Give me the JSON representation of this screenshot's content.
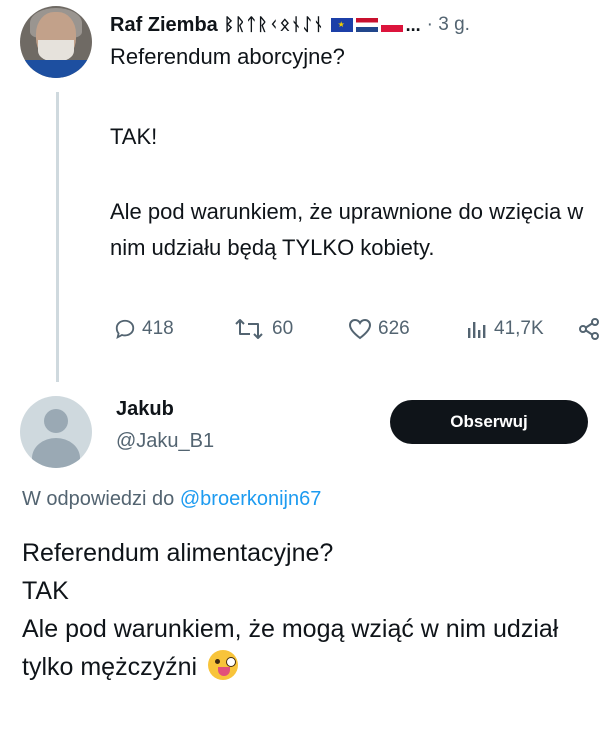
{
  "original_tweet": {
    "display_name": "Raf Ziemba",
    "name_runes": "ᛒᚱᛏᚱᚲᛟᚾᛇᚾ",
    "flags": [
      "eu-flag",
      "netherlands-flag",
      "poland-flag"
    ],
    "ellipsis": "...",
    "time": "· 3 g.",
    "lines": [
      "Referendum aborcyjne?",
      "TAK!",
      "Ale pod warunkiem, że uprawnione do wzięcia w nim udziału będą TYLKO kobiety."
    ],
    "stats": {
      "replies": "418",
      "retweets": "60",
      "likes": "626",
      "views": "41,7K"
    }
  },
  "reply": {
    "display_name": "Jakub",
    "handle": "@Jaku_B1",
    "follow_label": "Obserwuj",
    "context_prefix": "W odpowiedzi do ",
    "context_mention": "@broerkonijn67",
    "lines": [
      "Referendum alimentacyjne?",
      "TAK",
      "Ale pod warunkiem, że mogą wziąć w nim udział tylko mężczyźni"
    ],
    "emoji": "winking-face-with-tongue"
  },
  "colors": {
    "text": "#0f1419",
    "secondary": "#536471",
    "link": "#1d9bf0",
    "button_bg": "#0f1419",
    "thread_line": "#cfd9de"
  }
}
